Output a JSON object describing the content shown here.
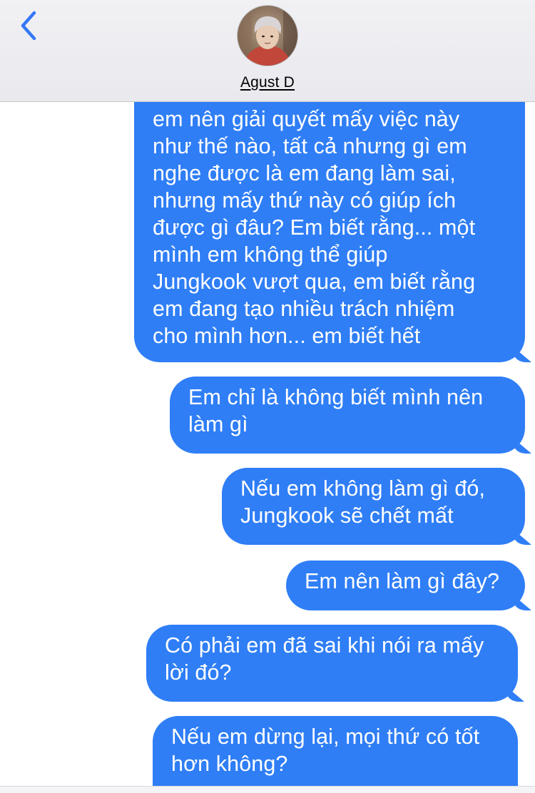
{
  "header": {
    "contact_name": "Agust D",
    "back_icon": "chevron-left-icon",
    "accent_color": "#3478f6"
  },
  "messages": [
    {
      "sender": "me",
      "text": "em nên giải quyết mấy việc này\nnhư thế nào, tất cả nhưng gì em\nnghe được là em đang làm sai,\nnhưng mấy thứ này có giúp ích\nđược gì đâu? Em biết rằng... một\nmình em không thể giúp\nJungkook vượt qua, em biết rằng\nem đang tạo nhiều trách nhiệm\ncho mình hơn... em biết hết"
    },
    {
      "sender": "me",
      "text": "Em chỉ là không biết mình nên\nlàm gì"
    },
    {
      "sender": "me",
      "text": "Nếu em không làm gì đó,\nJungkook sẽ chết mất"
    },
    {
      "sender": "me",
      "text": "Em nên làm gì đây?"
    },
    {
      "sender": "me",
      "text": "Có phải em đã sai khi nói ra mấy\nlời đó?"
    },
    {
      "sender": "me",
      "text": "Nếu em dừng lại, mọi thứ có tốt\nhơn không?"
    }
  ],
  "colors": {
    "bubble_sent": "#2f7ef6",
    "header_bg": "#eeeef2"
  }
}
